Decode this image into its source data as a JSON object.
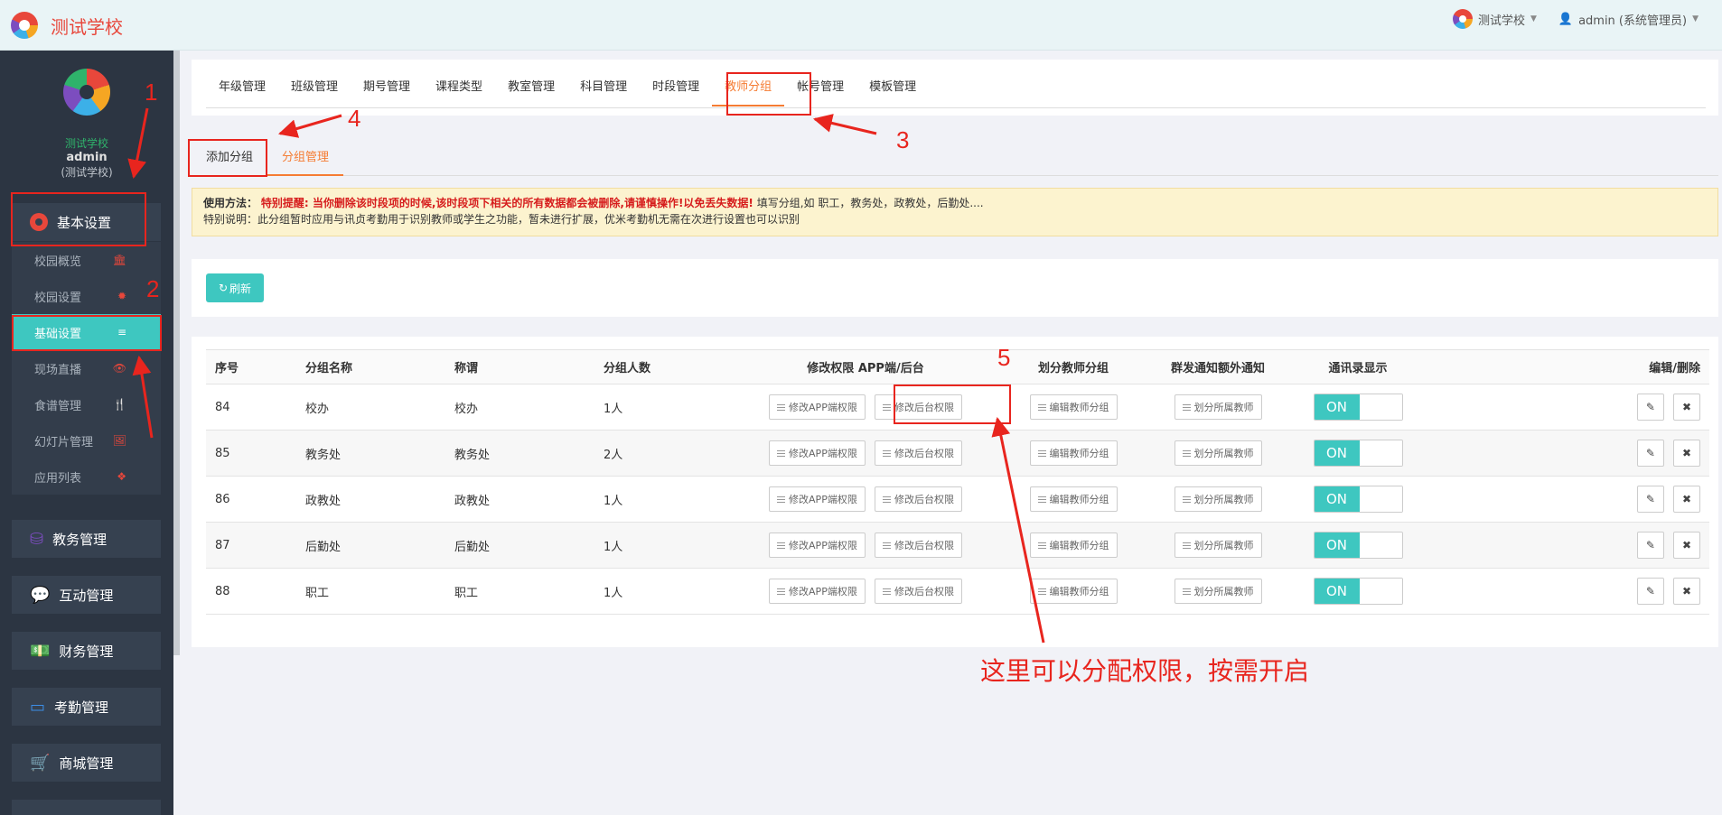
{
  "header": {
    "brand": "测试学校",
    "school_switch": "测试学校",
    "user": "admin (系统管理员)"
  },
  "sidebar": {
    "profile": {
      "school": "测试学校",
      "user": "admin",
      "role": "(测试学校)"
    },
    "sections": [
      {
        "label": "基本设置",
        "icon": "gear-icon"
      },
      {
        "label": "教务管理",
        "icon": "database-icon"
      },
      {
        "label": "互动管理",
        "icon": "wechat-icon"
      },
      {
        "label": "财务管理",
        "icon": "money-icon"
      },
      {
        "label": "考勤管理",
        "icon": "card-icon"
      },
      {
        "label": "商城管理",
        "icon": "cart-icon"
      }
    ],
    "basic_items": [
      {
        "label": "校园概览",
        "icon": "🏛"
      },
      {
        "label": "校园设置",
        "icon": "✹"
      },
      {
        "label": "基础设置",
        "icon": "≡"
      },
      {
        "label": "现场直播",
        "icon": "👁"
      },
      {
        "label": "食谱管理",
        "icon": "🍴"
      },
      {
        "label": "幻灯片管理",
        "icon": "🖼"
      },
      {
        "label": "应用列表",
        "icon": "❖"
      }
    ]
  },
  "top_tabs": [
    "年级管理",
    "班级管理",
    "期号管理",
    "课程类型",
    "教室管理",
    "科目管理",
    "时段管理",
    "教师分组",
    "帐号管理",
    "模板管理"
  ],
  "sub_tabs": [
    "添加分组",
    "分组管理"
  ],
  "notice": {
    "label": "使用方法：",
    "warning": "特别提醒: 当你删除该时段项的时候,该时段项下相关的所有数据都会被删除,请谨慎操作!以免丢失数据!",
    "rest": " 填写分组,如 职工，教务处，政教处，后勤处....",
    "line2": "特别说明：此分组暂时应用与讯贞考勤用于识别教师或学生之功能，暂未进行扩展，优米考勤机无需在次进行设置也可以识别"
  },
  "refresh_label": "刷新",
  "table": {
    "headers": [
      "序号",
      "分组名称",
      "称谓",
      "分组人数",
      "修改权限 APP端/后台",
      "划分教师分组",
      "群发通知额外通知",
      "通讯录显示",
      "编辑/删除"
    ],
    "buttons": {
      "app_perm": "修改APP端权限",
      "admin_perm": "修改后台权限",
      "edit_group": "编辑教师分组",
      "assign": "划分所属教师",
      "toggle_on": "ON"
    },
    "rows": [
      {
        "id": "84",
        "name": "校办",
        "title": "校办",
        "count": "1人"
      },
      {
        "id": "85",
        "name": "教务处",
        "title": "教务处",
        "count": "2人"
      },
      {
        "id": "86",
        "name": "政教处",
        "title": "政教处",
        "count": "1人"
      },
      {
        "id": "87",
        "name": "后勤处",
        "title": "后勤处",
        "count": "1人"
      },
      {
        "id": "88",
        "name": "职工",
        "title": "职工",
        "count": "1人"
      }
    ]
  },
  "annotations": {
    "numbers": [
      "1",
      "2",
      "3",
      "4",
      "5"
    ],
    "note": "这里可以分配权限，按需开启"
  },
  "colors": {
    "accent": "#3ec7c0",
    "active_tab": "#f57c33",
    "annotation": "#e8251e",
    "sidebar": "#2c3542"
  }
}
